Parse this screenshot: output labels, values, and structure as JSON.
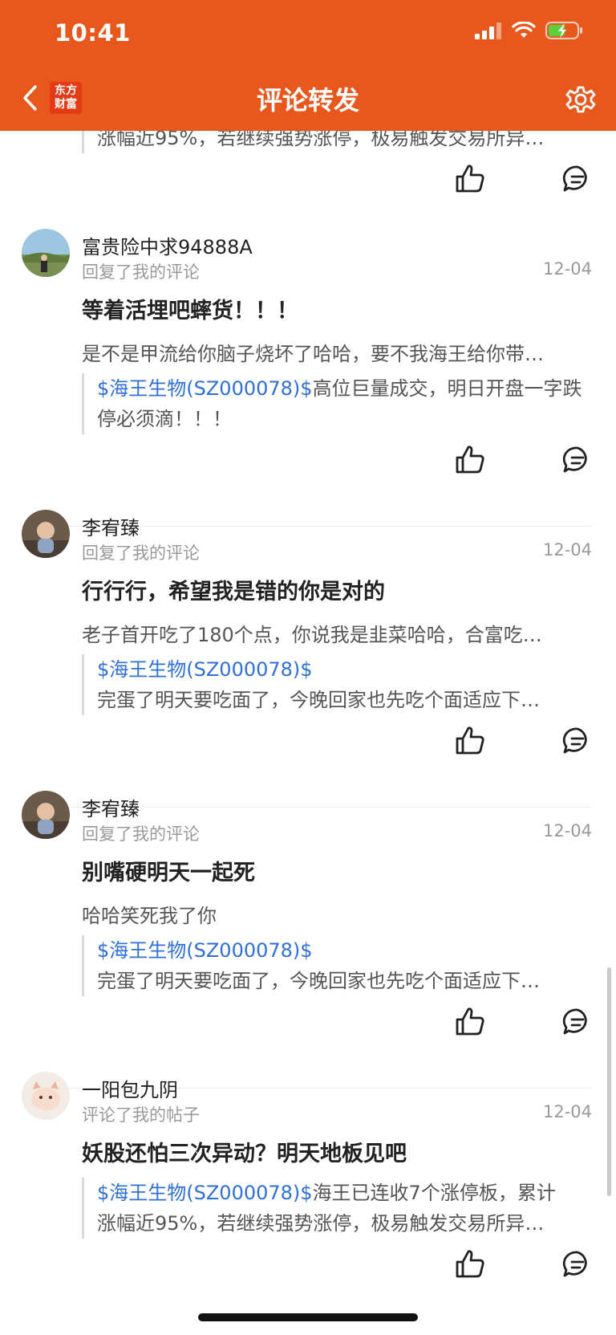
{
  "status_bar": {
    "time": "10:41"
  },
  "nav": {
    "title": "评论转发",
    "logo_line1": "东方",
    "logo_line2": "财富"
  },
  "colors": {
    "brand": "#e8581c",
    "stock_link": "#2f6fd6"
  },
  "top_partial": {
    "quote_text": "涨幅近95%，若继续强势涨停，极易触发交易所异…"
  },
  "items": [
    {
      "username": "富贵险中求94888A",
      "sub": "回复了我的评论",
      "date": "12-04",
      "title": "等着活埋吧蟀货！！！",
      "reply": "是不是甲流给你脑子烧坏了哈哈，要不我海王给你带…",
      "quote_stock": "$海王生物(SZ000078)$",
      "quote_text": "高位巨量成交，明日开盘一字跌停必须滴！！！"
    },
    {
      "username": "李宥臻",
      "sub": "回复了我的评论",
      "date": "12-04",
      "title": "行行行，希望我是错的你是对的",
      "reply": "老子首开吃了180个点，你说我是韭菜哈哈，合富吃…",
      "quote_stock": "$海王生物(SZ000078)$",
      "quote_text": "完蛋了明天要吃面了，今晚回家也先吃个面适应下…"
    },
    {
      "username": "李宥臻",
      "sub": "回复了我的评论",
      "date": "12-04",
      "title": "别嘴硬明天一起死",
      "reply": "哈哈笑死我了你",
      "quote_stock": "$海王生物(SZ000078)$",
      "quote_text": "完蛋了明天要吃面了，今晚回家也先吃个面适应下…"
    },
    {
      "username": "一阳包九阴",
      "sub": "评论了我的帖子",
      "date": "12-04",
      "title": "妖股还怕三次异动？明天地板见吧",
      "quote_stock": "$海王生物(SZ000078)$",
      "quote_text_1": "海王已连收7个涨停板，累计",
      "quote_text_2": "涨幅近95%，若继续强势涨停，极易触发交易所异…"
    }
  ]
}
